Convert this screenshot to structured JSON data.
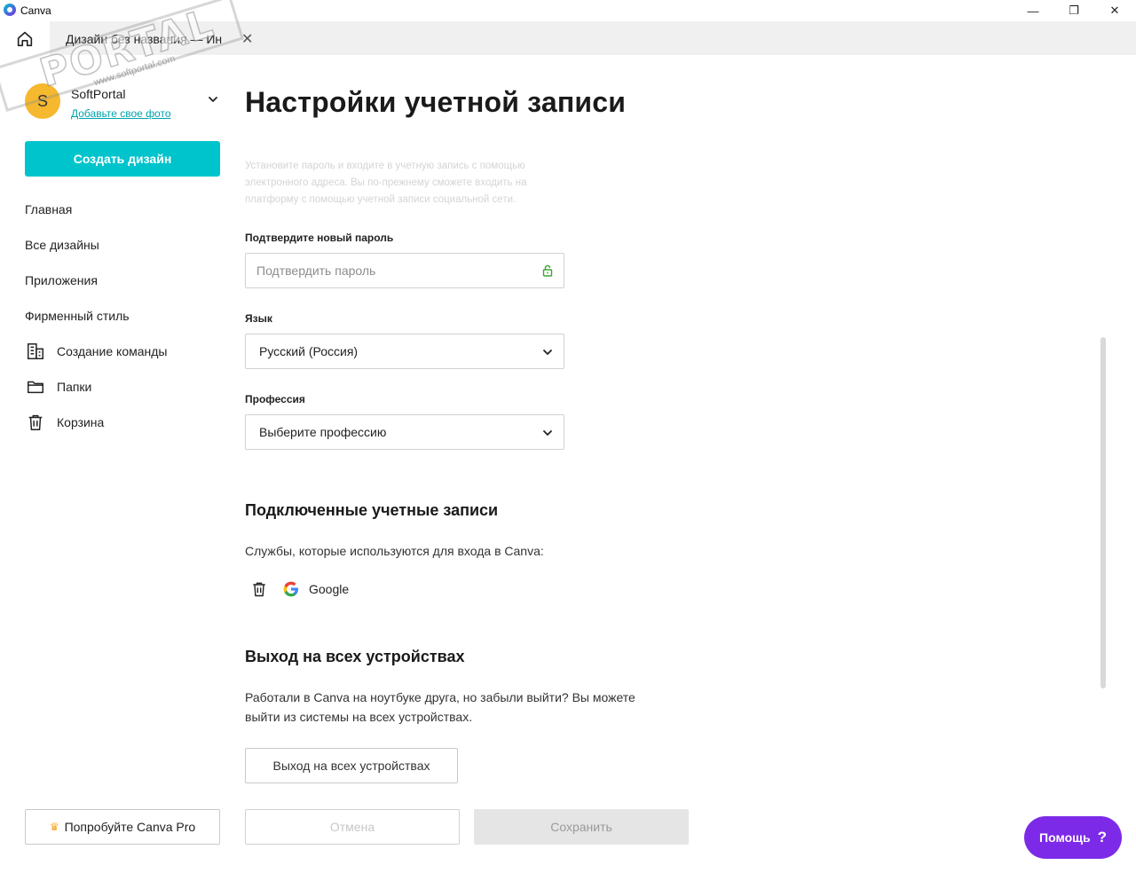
{
  "window": {
    "app_title": "Canva",
    "minimize": "—",
    "maximize": "❐",
    "close": "✕"
  },
  "tab": {
    "label": "Дизайн без названия — Ин",
    "close": "✕"
  },
  "watermark": {
    "text": "PORTAL",
    "url": "www.softportal.com"
  },
  "sidebar": {
    "avatar_letter": "S",
    "profile_name": "SoftPortal",
    "add_photo": "Добавьте свое фото",
    "create_design": "Создать дизайн",
    "nav": [
      {
        "label": "Главная",
        "icon": ""
      },
      {
        "label": "Все дизайны",
        "icon": ""
      },
      {
        "label": "Приложения",
        "icon": ""
      },
      {
        "label": "Фирменный стиль",
        "icon": ""
      },
      {
        "label": "Создание команды",
        "icon": "building-icon"
      },
      {
        "label": "Папки",
        "icon": "folder-icon"
      },
      {
        "label": "Корзина",
        "icon": "trash-icon"
      }
    ],
    "try_pro": "Попробуйте Canva Pro"
  },
  "main": {
    "title": "Настройки учетной записи",
    "hint": "Установите пароль и входите в учетную запись с помощью электронного адреса. Вы по-прежнему сможете входить на платформу с помощью учетной записи социальной сети.",
    "confirm_password_label": "Подтвердите новый пароль",
    "confirm_password_placeholder": "Подтвердить пароль",
    "language_label": "Язык",
    "language_value": "Русский (Россия)",
    "profession_label": "Профессия",
    "profession_value": "Выберите профессию",
    "connected_title": "Подключенные учетные записи",
    "connected_desc": "Службы, которые используются для входа в Canva:",
    "service_name": "Google",
    "logout_title": "Выход на всех устройствах",
    "logout_desc": "Работали в Canva на ноутбуке друга, но забыли выйти? Вы можете выйти из системы на всех устройствах.",
    "logout_button": "Выход на всех устройствах",
    "cancel_button": "Отмена",
    "save_button": "Сохранить"
  },
  "help": {
    "label": "Помощь",
    "icon": "?"
  },
  "colors": {
    "accent": "#00c4cc",
    "help": "#7d2ae8",
    "avatar": "#f5b82e"
  }
}
